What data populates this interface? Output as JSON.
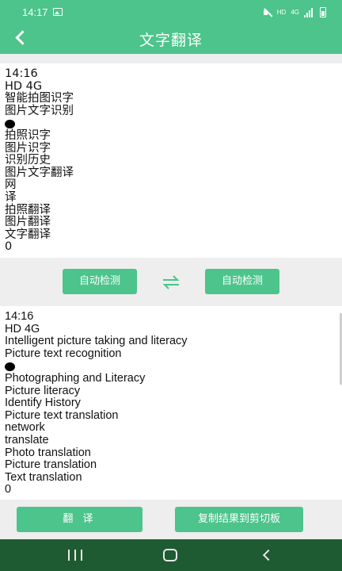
{
  "status_bar": {
    "time": "14:17",
    "network_label": "HD",
    "signal_label": "4G"
  },
  "header": {
    "title": "文字翻译"
  },
  "source_text": {
    "lines": [
      "14:16",
      "HD 4G",
      "智能拍图识字",
      "图片文字识别",
      "●",
      "拍照识字",
      "图片识字",
      "识别历史",
      "图片文字翻译",
      "网",
      "译",
      "拍照翻译",
      "图片翻译",
      "文字翻译",
      "0"
    ]
  },
  "language_bar": {
    "source_lang": "自动检测",
    "target_lang": "自动检测",
    "swap_icon": "swap-arrows-icon"
  },
  "result_text": {
    "lines": [
      "14:16",
      "HD 4G",
      "Intelligent picture taking and literacy",
      "Picture text recognition",
      "●",
      "Photographing and Literacy",
      "Picture literacy",
      "Identify History",
      "Picture text translation",
      "network",
      "translate",
      "Photo translation",
      "Picture translation",
      "Text translation",
      "0"
    ]
  },
  "actions": {
    "translate_label": "翻 译",
    "copy_label": "复制结果到剪切板"
  },
  "colors": {
    "accent": "#4cc48b",
    "nav_bar": "#1e5a32",
    "background": "#eeeeee"
  }
}
